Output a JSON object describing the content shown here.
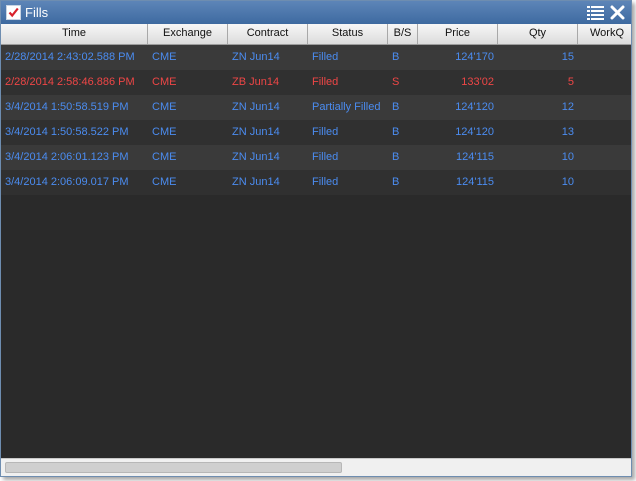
{
  "window": {
    "title": "Fills"
  },
  "colors": {
    "buy": "#4b8cf0",
    "sell": "#ee4646",
    "titlebar": "#4a76ad"
  },
  "icons": {
    "title_check": "check-icon",
    "list": "list-icon",
    "close": "close-icon"
  },
  "table": {
    "columns": [
      "Time",
      "Exchange",
      "Contract",
      "Status",
      "B/S",
      "Price",
      "Qty",
      "WorkQ"
    ],
    "rows": [
      {
        "time": "2/28/2014 2:43:02.588 PM",
        "exchange": "CME",
        "contract": "ZN Jun14",
        "status": "Filled",
        "bs": "B",
        "price": "124'170",
        "qty": "15",
        "work": "",
        "side": "buy"
      },
      {
        "time": "2/28/2014 2:58:46.886 PM",
        "exchange": "CME",
        "contract": "ZB Jun14",
        "status": "Filled",
        "bs": "S",
        "price": "133'02",
        "qty": "5",
        "work": "",
        "side": "sell"
      },
      {
        "time": "3/4/2014 1:50:58.519 PM",
        "exchange": "CME",
        "contract": "ZN Jun14",
        "status": "Partially Filled",
        "bs": "B",
        "price": "124'120",
        "qty": "12",
        "work": "",
        "side": "buy"
      },
      {
        "time": "3/4/2014 1:50:58.522 PM",
        "exchange": "CME",
        "contract": "ZN Jun14",
        "status": "Filled",
        "bs": "B",
        "price": "124'120",
        "qty": "13",
        "work": "",
        "side": "buy"
      },
      {
        "time": "3/4/2014 2:06:01.123 PM",
        "exchange": "CME",
        "contract": "ZN Jun14",
        "status": "Filled",
        "bs": "B",
        "price": "124'115",
        "qty": "10",
        "work": "",
        "side": "buy"
      },
      {
        "time": "3/4/2014 2:06:09.017 PM",
        "exchange": "CME",
        "contract": "ZN Jun14",
        "status": "Filled",
        "bs": "B",
        "price": "124'115",
        "qty": "10",
        "work": "",
        "side": "buy"
      }
    ]
  }
}
